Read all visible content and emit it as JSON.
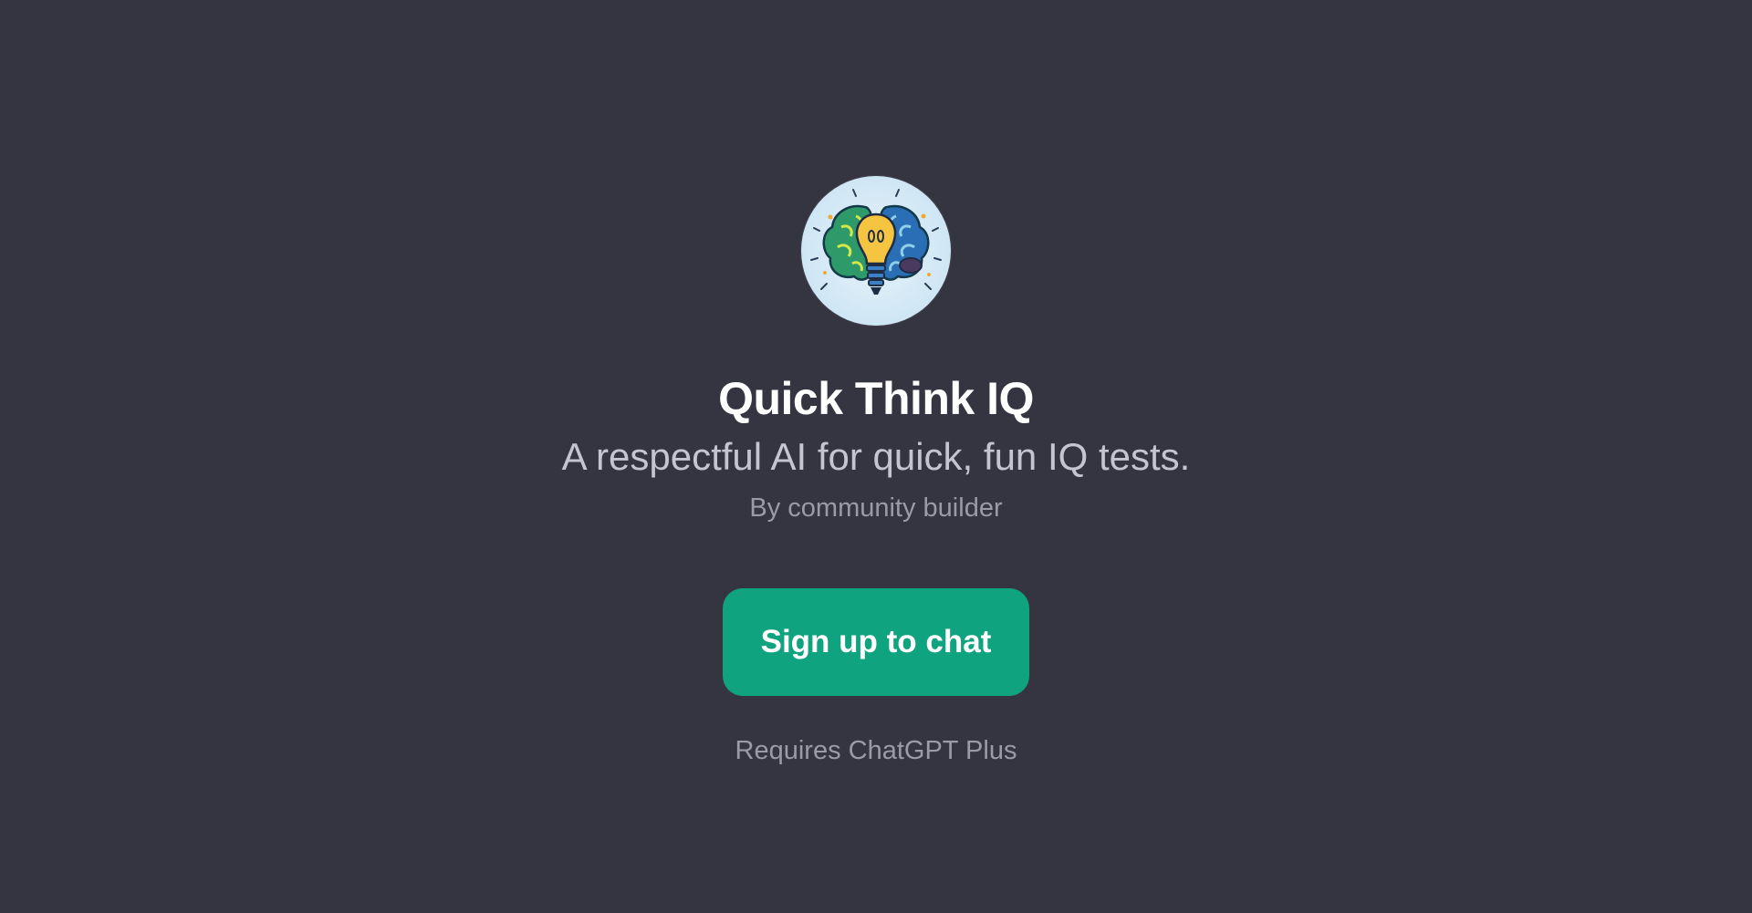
{
  "gpt": {
    "avatar_icon": "brain-lightbulb-icon",
    "title": "Quick Think IQ",
    "description": "A respectful AI for quick, fun IQ tests.",
    "author": "By community builder"
  },
  "actions": {
    "signup_label": "Sign up to chat",
    "requirement": "Requires ChatGPT Plus"
  },
  "colors": {
    "background": "#343541",
    "accent": "#10a37f",
    "title": "#ffffff",
    "subtitle": "#c5c5d2",
    "muted": "#9a9aa8"
  }
}
